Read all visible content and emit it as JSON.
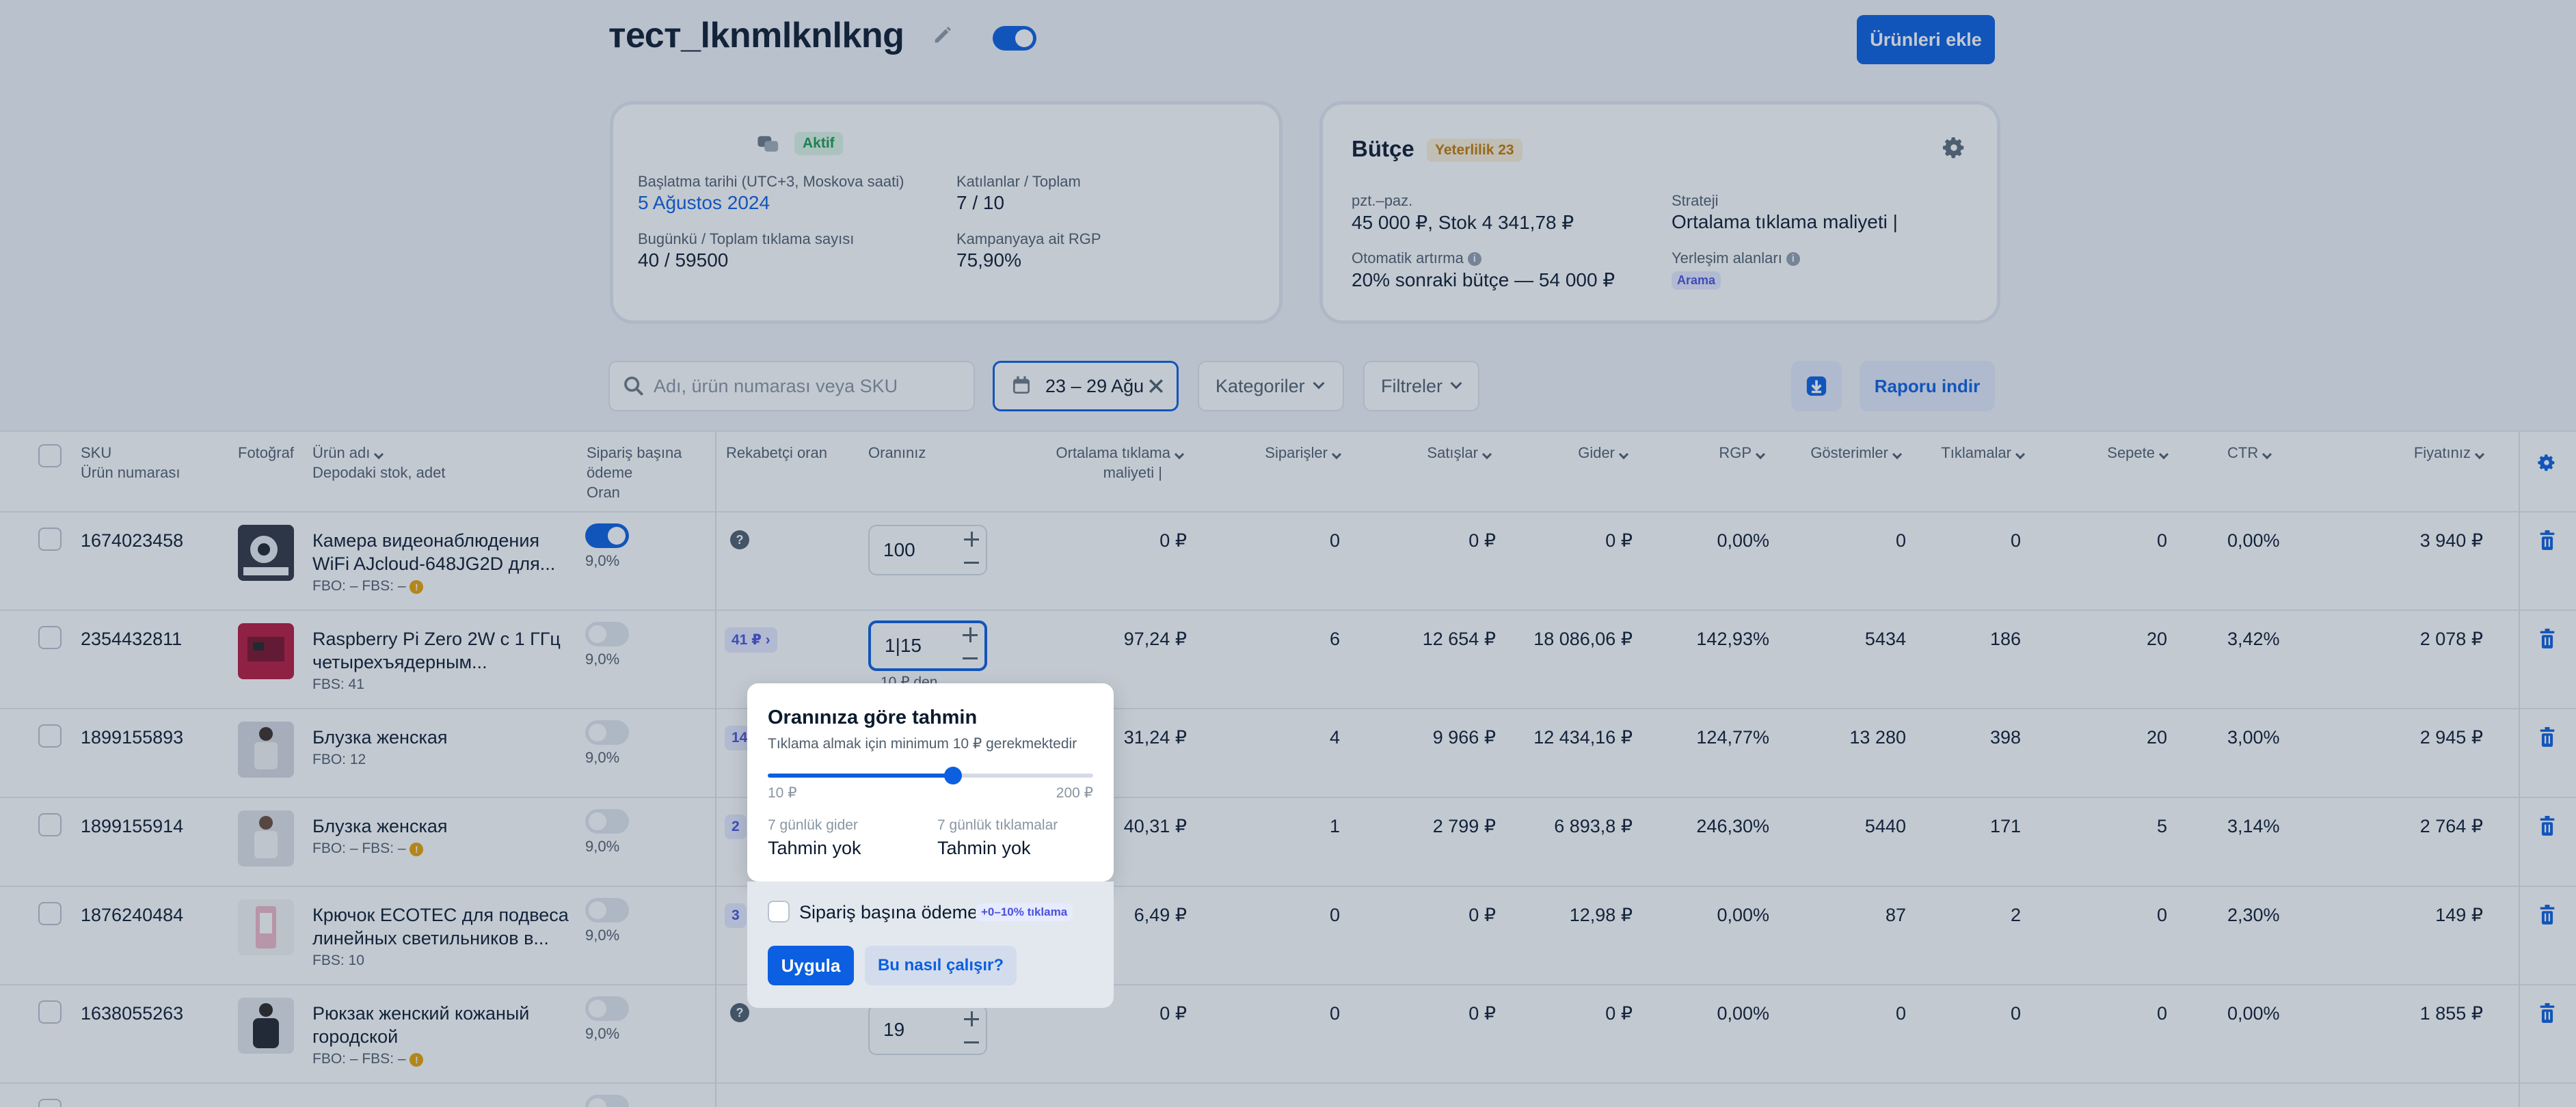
{
  "header": {
    "campaign_title": "тест_lknmlknlkng",
    "add_products_label": "Ürünleri ekle"
  },
  "campaign_card": {
    "status": "Aktif",
    "start_label": "Başlatma tarihi (UTC+3, Moskova saati)",
    "start_value": "5 Ağustos 2024",
    "participants_label": "Katılanlar / Toplam",
    "participants_value": "7 / 10",
    "clicks_label": "Bugünkü / Toplam tıklama sayısı",
    "clicks_value": "40 / 59500",
    "rgp_label": "Kampanyaya ait RGP",
    "rgp_value": "75,90%"
  },
  "budget_card": {
    "title": "Bütçe",
    "badge": "Yeterlilik 23",
    "period_label": "pzt.–paz.",
    "period_value": "45 000 ₽, Stok 4 341,78 ₽",
    "strategy_label": "Strateji",
    "strategy_value": "Ortalama tıklama maliyeti |",
    "auto_label": "Otomatik artırma",
    "auto_value": "20% sonraki bütçe — 54 000 ₽",
    "placement_label": "Yerleşim alanları",
    "placement_badge": "Arama"
  },
  "toolbar": {
    "search_placeholder": "Adı, ürün numarası veya SKU",
    "date_range": "23 – 29 Ağu",
    "categories": "Kategoriler",
    "filters": "Filtreler",
    "report": "Raporu indir"
  },
  "columns": {
    "sku": "SKU",
    "sku_sub": "Ürün numarası",
    "photo": "Fotoğraf",
    "name": "Ürün adı",
    "name_sub": "Depodaki stok, adet",
    "pay_per_order": "Sipariş başına",
    "pay_per_order_2": "ödeme",
    "pay_per_order_sub": "Oran",
    "competitor": "Rekabetçi oran",
    "your_bid": "Oranınız",
    "avg_cpc": "Ortalama tıklama",
    "avg_cpc_2": "maliyeti |",
    "orders": "Siparişler",
    "sales": "Satışlar",
    "expense": "Gider",
    "rgp": "RGP",
    "impressions": "Gösterimler",
    "clicks": "Tıklamalar",
    "cart": "Sepete",
    "ctr": "CTR",
    "price": "Fiyatınız"
  },
  "rows": [
    {
      "sku": "1674023458",
      "name1": "Камера видеонаблюдения",
      "name2": "WiFi AJcloud-648JG2D для...",
      "stock": "FBO: –   FBS: –",
      "pct": "9,0%",
      "bid": "100",
      "cpc": "0 ₽",
      "orders": "0",
      "sales": "0 ₽",
      "expense": "0 ₽",
      "rgp": "0,00%",
      "impr": "0",
      "clicks": "0",
      "cart": "0",
      "ctr": "0,00%",
      "price": "3 940 ₽"
    },
    {
      "sku": "2354432811",
      "name1": "Raspberry Pi Zero 2W с 1 ГГц",
      "name2": "четырехъядерным...",
      "stock": "FBS: 41",
      "pct": "9,0%",
      "compet": "41 ₽",
      "bid": "1|15",
      "bid_note": "10 ₽ den",
      "cpc": "97,24 ₽",
      "orders": "6",
      "sales": "12 654 ₽",
      "expense": "18 086,06 ₽",
      "rgp": "142,93%",
      "impr": "5434",
      "clicks": "186",
      "cart": "20",
      "ctr": "3,42%",
      "price": "2 078 ₽"
    },
    {
      "sku": "1899155893",
      "name1": "Блузка женская",
      "name2": "",
      "stock": "FBO: 12",
      "pct": "9,0%",
      "compet": "14",
      "cpc": "31,24 ₽",
      "orders": "4",
      "sales": "9 966 ₽",
      "expense": "12 434,16 ₽",
      "rgp": "124,77%",
      "impr": "13 280",
      "clicks": "398",
      "cart": "20",
      "ctr": "3,00%",
      "price": "2 945 ₽"
    },
    {
      "sku": "1899155914",
      "name1": "Блузка женская",
      "name2": "",
      "stock": "FBO: –   FBS: –",
      "pct": "9,0%",
      "compet": "2",
      "cpc": "40,31 ₽",
      "orders": "1",
      "sales": "2 799 ₽",
      "expense": "6 893,8 ₽",
      "rgp": "246,30%",
      "impr": "5440",
      "clicks": "171",
      "cart": "5",
      "ctr": "3,14%",
      "price": "2 764 ₽"
    },
    {
      "sku": "1876240484",
      "name1": "Крючок ECOTEC для подвеса",
      "name2": "линейных светильников в...",
      "stock": "FBS: 10",
      "pct": "9,0%",
      "compet": "3",
      "cpc": "6,49 ₽",
      "orders": "0",
      "sales": "0 ₽",
      "expense": "12,98 ₽",
      "rgp": "0,00%",
      "impr": "87",
      "clicks": "2",
      "cart": "0",
      "ctr": "2,30%",
      "price": "149 ₽"
    },
    {
      "sku": "1638055263",
      "name1": "Рюкзак женский кожаный",
      "name2": "городской",
      "stock": "FBO: –   FBS: –",
      "pct": "9,0%",
      "bid": "19",
      "cpc": "0 ₽",
      "orders": "0",
      "sales": "0 ₽",
      "expense": "0 ₽",
      "rgp": "0,00%",
      "impr": "0",
      "clicks": "0",
      "cart": "0",
      "ctr": "0,00%",
      "price": "1 855 ₽"
    }
  ],
  "popup": {
    "title": "Oranınıza göre tahmin",
    "subtitle": "Tıklama almak için minimum 10 ₽ gerekmektedir",
    "min": "10 ₽",
    "max": "200 ₽",
    "slider_fraction": 0.57,
    "expense_label": "7 günlük gider",
    "expense_value": "Tahmin yok",
    "clicks_label": "7 günlük tıklamalar",
    "clicks_value": "Tahmin yok",
    "ppo_label": "Sipariş başına ödeme",
    "ppo_badge": "+0–10% tıklama",
    "apply": "Uygula",
    "how": "Bu nasıl çalışır?"
  },
  "colors": {
    "accent": "#0b5fe0",
    "success": "#1a9b4b",
    "warning": "#e8a200"
  }
}
